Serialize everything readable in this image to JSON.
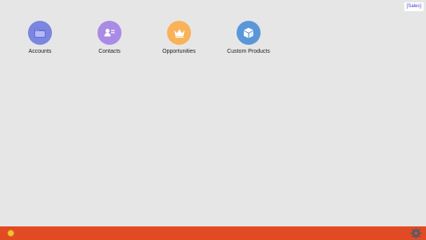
{
  "context_badge": "[Sales]",
  "tiles": [
    {
      "label": "Accounts",
      "icon": "folder-icon",
      "color": "#7b86e0"
    },
    {
      "label": "Contacts",
      "icon": "contact-card-icon",
      "color": "#a98be6"
    },
    {
      "label": "Opportunities",
      "icon": "crown-icon",
      "color": "#f8b35a"
    },
    {
      "label": "Custom Products",
      "icon": "box-icon",
      "color": "#5a97d8"
    }
  ],
  "bottom_bar": {
    "color": "#e24a24",
    "status_icon": "status-dot-icon",
    "settings_icon": "gear-icon"
  }
}
